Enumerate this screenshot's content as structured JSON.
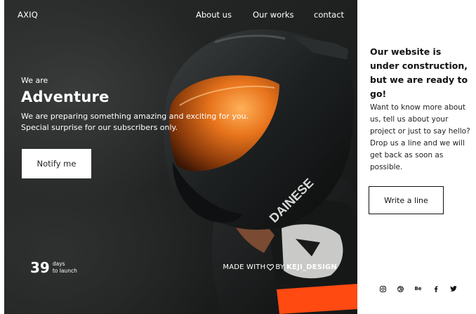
{
  "nav": {
    "brand": "AXIQ",
    "links": [
      "About us",
      "Our works",
      "contact"
    ]
  },
  "hero": {
    "pre_title": "We are",
    "title": "Adventure",
    "description": "We are preparing something amazing and exciting for you. Special surprise for our subscribers only.",
    "notify_label": "Notify me"
  },
  "countdown": {
    "value": "39",
    "unit": "days",
    "suffix": "to launch"
  },
  "credit": {
    "made": "MADE WITH",
    "by": "BY",
    "designer": "KEJI_DESIGN",
    "icon": "heart-icon"
  },
  "panel": {
    "title": "Our website is under construction, but we are ready to go!",
    "text": "Want to know more about us, tell us about your project or just to say hello? Drop us a line and we will get back as soon as possible.",
    "button_label": "Write a line"
  },
  "social": {
    "behance_label": "Be",
    "icons": [
      "instagram-icon",
      "dribbble-icon",
      "behance-icon",
      "facebook-icon",
      "twitter-icon"
    ]
  },
  "colors": {
    "hero_bg": "#1e2020",
    "visor_orange": "#e8741c",
    "suit_orange": "#ff4a12",
    "text_light": "#ffffff",
    "text_dark": "#111111"
  }
}
